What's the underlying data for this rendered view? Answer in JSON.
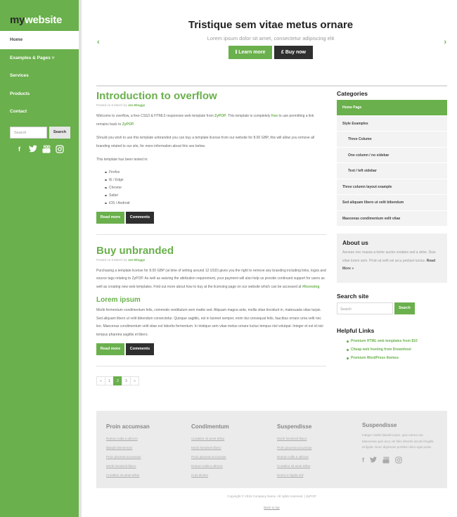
{
  "brand": {
    "logo_my": "my",
    "logo_website": "website"
  },
  "nav": {
    "items": [
      "Home",
      "Examples & Pages ˅",
      "Services",
      "Products",
      "Contact"
    ]
  },
  "side_search": {
    "placeholder": "Search",
    "button": "Search"
  },
  "social_icons": [
    "facebook-icon",
    "twitter-icon",
    "youtube-icon",
    "instagram-icon"
  ],
  "hero": {
    "title": "Tristique sem vitae metus ornare",
    "subtitle": "Lorem ipsum dolor sit amet, consectetur adipiscing elit",
    "btn_learn": "ℹ  Learn more",
    "btn_buy": "£  Buy now",
    "arrow_left": "‹",
    "arrow_right": "›"
  },
  "post1": {
    "title": "Introduction to overflow",
    "meta_prefix": "Posted on 6 March by ",
    "meta_author": "Joe Bloggs",
    "p1_a": "Welcome to overflow, a free CSS3 & HTML5 responsive web template from ",
    "p1_link": "ZyPOP",
    "p1_b": ". This template is completely ",
    "p1_free": "free",
    "p1_c": " to use permitting a link remains back to ",
    "p1_link2": "ZyPOP",
    "p1_d": ".",
    "p2": "Should you wish to use this template unbranded you can buy a template license from our website for 8.00 GBP, this will allow you remove all branding related to our site, for more information about this see below.",
    "p3": "This template has been tested in:",
    "browsers": [
      "Firefox",
      "IE / Edge",
      "Chrome",
      "Safari",
      "iOS / Android"
    ],
    "read_more": "Read more",
    "comments": "Comments"
  },
  "post2": {
    "title": "Buy unbranded",
    "meta_prefix": "Posted on 6 March by ",
    "meta_author": "Joe Bloggs",
    "p1": "Purchasing a template license for 8.00 GBP (at time of writing around 12 USD) gives you the right to remove any branding including links, logos and source tags relating to ZyPOP. As well as waiving the attribution requirement, your payment will also help us provide continued support for users as well as creating new web templates. Find out more about how to buy at the licensing page on our website which can be accessed at ",
    "p1_link": "#licensing",
    "sub_title": "Lorem ipsum",
    "p2": "Morbi fermentum condimentum felis, commodo vestibulum sem mattis sed. Aliquam magna ante, mollis vitae tincidunt in, malesuada vitae turpis. Sed aliquam libero ut velit bibendum consectetur. Quisque sagittis, est in laoreet semper, enim dui consequat felis, faucibus ornare urna velit nec leo. Maecenas condimentum velit vitae est lobortis fermentum. In tristique sem vitae metus ornare luctus tempus nisl volutpat. Integer et est id nisi tempus pharetra sagittis et libero.",
    "read_more": "Read more",
    "comments": "Comments"
  },
  "pager": [
    "«",
    "1",
    "2",
    "3",
    "»"
  ],
  "categories": {
    "heading": "Categories",
    "items": [
      {
        "label": "Home Page",
        "level": 0,
        "active": true
      },
      {
        "label": "Style Examples",
        "level": 0,
        "active": false
      },
      {
        "label": "Three Column",
        "level": 1,
        "active": false
      },
      {
        "label": "One column / no sidebar",
        "level": 1,
        "active": false
      },
      {
        "label": "Text / left sidebar",
        "level": 1,
        "active": false
      },
      {
        "label": "Three column layout example",
        "level": 0,
        "active": false
      },
      {
        "label": "Sed aliquam libero ut velit bibendum",
        "level": 0,
        "active": false
      },
      {
        "label": "Maecenas condimentum velit vitae",
        "level": 0,
        "active": false
      }
    ]
  },
  "about": {
    "heading": "About us",
    "text": "Aenean nec massa a tortor auctor sodales sed a dolor. Duis vitae lorem sem. Proin at velit vel arcu pretium luctus. ",
    "read_more": "Read More »"
  },
  "search_site": {
    "heading": "Search site",
    "placeholder": "Search",
    "button": "Search"
  },
  "helpful_links": {
    "heading": "Helpful Links",
    "items": [
      "Premium HTML web templates from $10",
      "Cheap web hosting from Dreamhost",
      "Premium WordPress themes"
    ]
  },
  "footer": {
    "col1": {
      "heading": "Proin accumsan",
      "links": [
        "Rutrum nulla a ultrices",
        "Blandit elementum",
        "Proin placerat accumsan",
        "Morbi hendrerit libero",
        "Curabitur sit amet tellus"
      ]
    },
    "col2": {
      "heading": "Condimentum",
      "links": [
        "Curabitur sit amet tellus",
        "Morbi hendrerit libero",
        "Proin placerat accumsan",
        "Rutrum nulla a ultrices",
        "Cras dictum"
      ]
    },
    "col3": {
      "heading": "Suspendisse",
      "links": [
        "Morbi hendrerit libero",
        "Proin placerat accumsan",
        "Rutrum nulla a ultrices",
        "Curabitur sit amet tellus",
        "Donec in ligula nisl"
      ]
    },
    "col4": {
      "heading": "Suspendisse",
      "text": "Integer mattis blandit turpis, quis rutrum est. Maecenas quis arcu vel felis lobortis iaculis fringilla at ligula. Nunc dignissim porttitor dolor eget porta."
    },
    "copyright": "Copyright © 2016 Company Name. All rights reserved. | ZyPOP",
    "back_to_top": "Back to top"
  }
}
